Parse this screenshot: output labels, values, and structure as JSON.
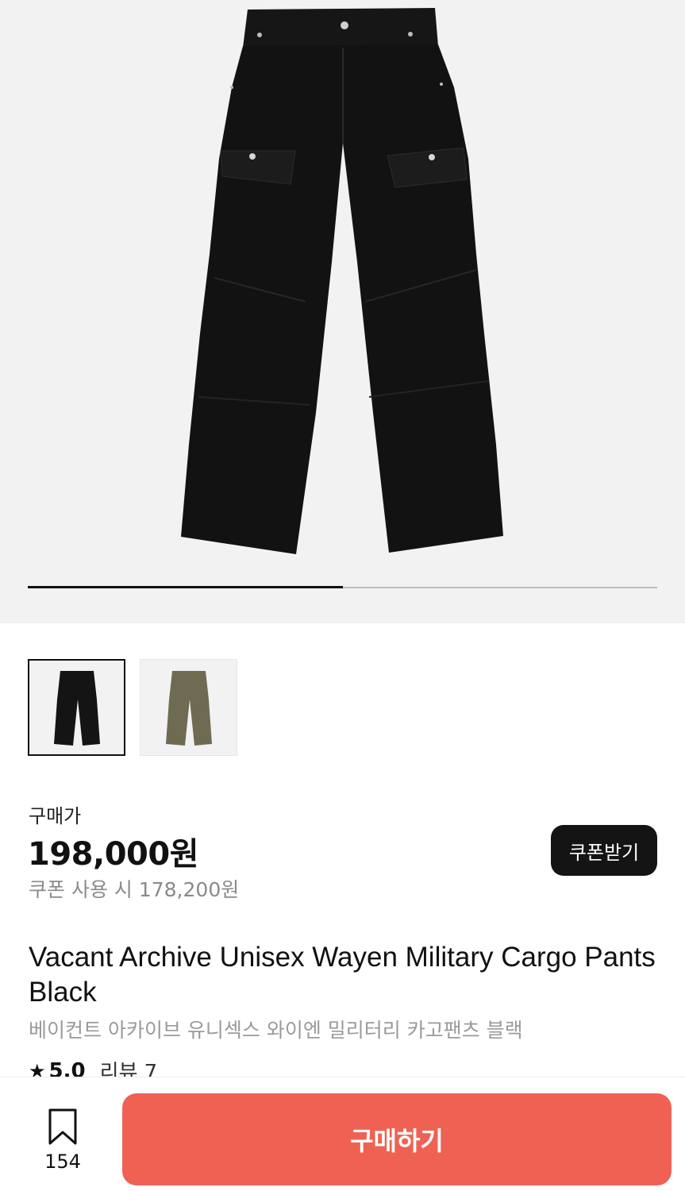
{
  "gallery": {
    "current_image": 1,
    "total_images": 2,
    "thumbnails": [
      {
        "color": "#141414",
        "label": "black",
        "selected": true
      },
      {
        "color": "#6f6b52",
        "label": "khaki",
        "selected": false
      }
    ]
  },
  "pricing": {
    "label": "구매가",
    "price": "198,000원",
    "coupon_price": "쿠폰 사용 시 178,200원",
    "coupon_button": "쿠폰받기"
  },
  "product": {
    "title_en": "Vacant Archive Unisex Wayen Military Cargo Pants Black",
    "title_ko": "베이컨트 아카이브 유니섹스 와이엔 밀리터리 카고팬츠 블랙",
    "rating": "5.0",
    "reviews": "리뷰 7"
  },
  "bottom_bar": {
    "bookmark_count": "154",
    "buy_button": "구매하기"
  },
  "colors": {
    "accent": "#ef6253",
    "dark": "#141414",
    "muted": "#9a9a9a"
  },
  "icons": [
    "star-icon",
    "bookmark-icon"
  ]
}
